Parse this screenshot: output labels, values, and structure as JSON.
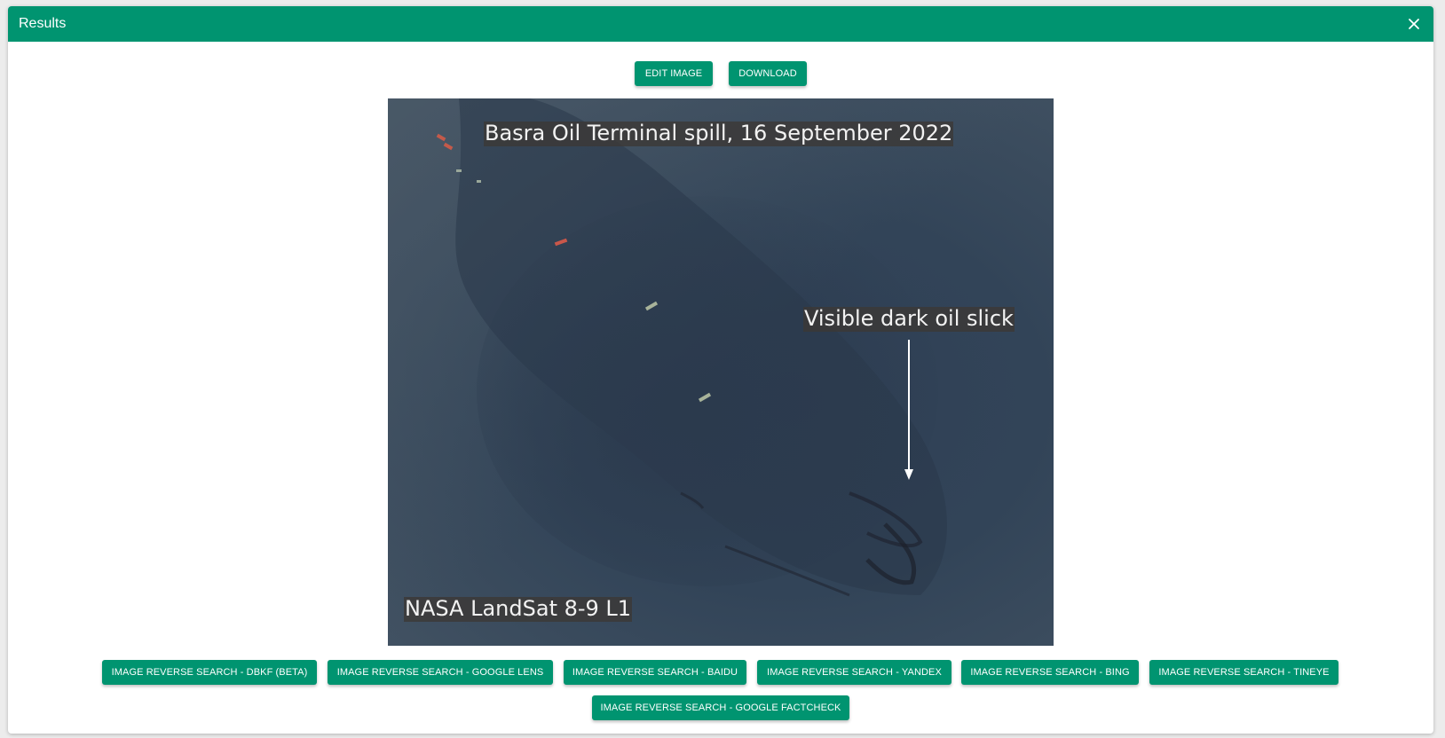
{
  "dialog": {
    "title": "Results",
    "close_icon": "close-icon"
  },
  "toolbar": {
    "edit_label": "EDIT IMAGE",
    "download_label": "DOWNLOAD"
  },
  "image": {
    "title_overlay": "Basra Oil Terminal spill, 16 September 2022",
    "annotation": "Visible dark oil slick",
    "credit": "NASA LandSat 8-9 L1"
  },
  "search_buttons": [
    "IMAGE REVERSE SEARCH - DBKF (BETA)",
    "IMAGE REVERSE SEARCH - GOOGLE LENS",
    "IMAGE REVERSE SEARCH - BAIDU",
    "IMAGE REVERSE SEARCH - YANDEX",
    "IMAGE REVERSE SEARCH - BING",
    "IMAGE REVERSE SEARCH - TINEYE",
    "IMAGE REVERSE SEARCH - GOOGLE FACTCHECK"
  ],
  "colors": {
    "accent": "#009470",
    "button_text": "#ffffff",
    "background": "#ffffff"
  }
}
